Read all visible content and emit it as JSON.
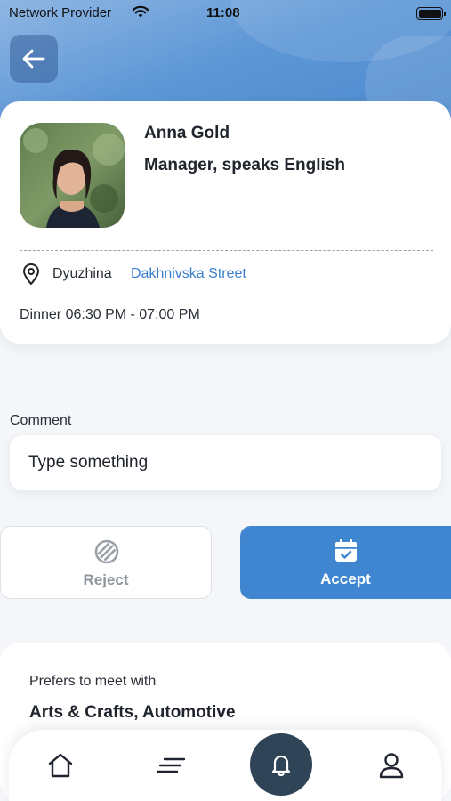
{
  "status_bar": {
    "carrier": "Network Provider",
    "time": "11:08"
  },
  "profile": {
    "name": "Anna Gold",
    "role": "Manager, speaks English",
    "location_city": "Dyuzhina",
    "location_street": "Dakhnivska Street",
    "meal_time": "Dinner 06:30 PM - 07:00 PM"
  },
  "comment": {
    "label": "Comment",
    "placeholder": "Type something"
  },
  "actions": {
    "reject_label": "Reject",
    "accept_label": "Accept"
  },
  "preferences": {
    "label": "Prefers to meet with",
    "value": "Arts & Crafts, Automotive"
  },
  "nav": {
    "items": [
      "home-icon",
      "feed-icon",
      "bell-icon",
      "profile-icon"
    ],
    "active": "bell-icon"
  },
  "colors": {
    "accent": "#3f85cf",
    "link": "#3a7fcf",
    "nav_active_bg": "#2f4457"
  }
}
